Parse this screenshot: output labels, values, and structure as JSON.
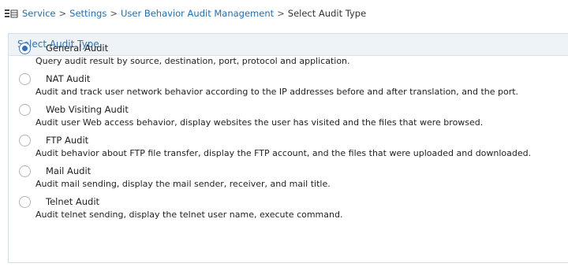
{
  "breadcrumb": {
    "icon": "settings-list-icon",
    "items": [
      "Service",
      "Settings",
      "User Behavior Audit Management"
    ],
    "separator": ">",
    "current": "Select Audit Type"
  },
  "panel": {
    "title": "Select Audit Type"
  },
  "options": [
    {
      "label": "General Audit",
      "description": "Query audit result by source, destination, port, protocol and application.",
      "selected": true
    },
    {
      "label": "NAT Audit",
      "description": "Audit and track user network behavior according to the IP addresses before and after translation, and the port.",
      "selected": false
    },
    {
      "label": "Web Visiting Audit",
      "description": "Audit user Web access behavior, display websites the user has visited and the files that were browsed.",
      "selected": false
    },
    {
      "label": "FTP Audit",
      "description": "Audit behavior about FTP file transfer, display the FTP account, and the files that were uploaded and downloaded.",
      "selected": false
    },
    {
      "label": "Mail Audit",
      "description": "Audit mail sending, display the mail sender, receiver, and mail title.",
      "selected": false
    },
    {
      "label": "Telnet Audit",
      "description": "Audit telnet sending, display the telnet user name, execute command.",
      "selected": false
    }
  ],
  "colors": {
    "link": "#1f6fb5",
    "header_bg": "#eef3f8",
    "header_text": "#2f74b9",
    "radio_selected": "#2f6fc2"
  }
}
